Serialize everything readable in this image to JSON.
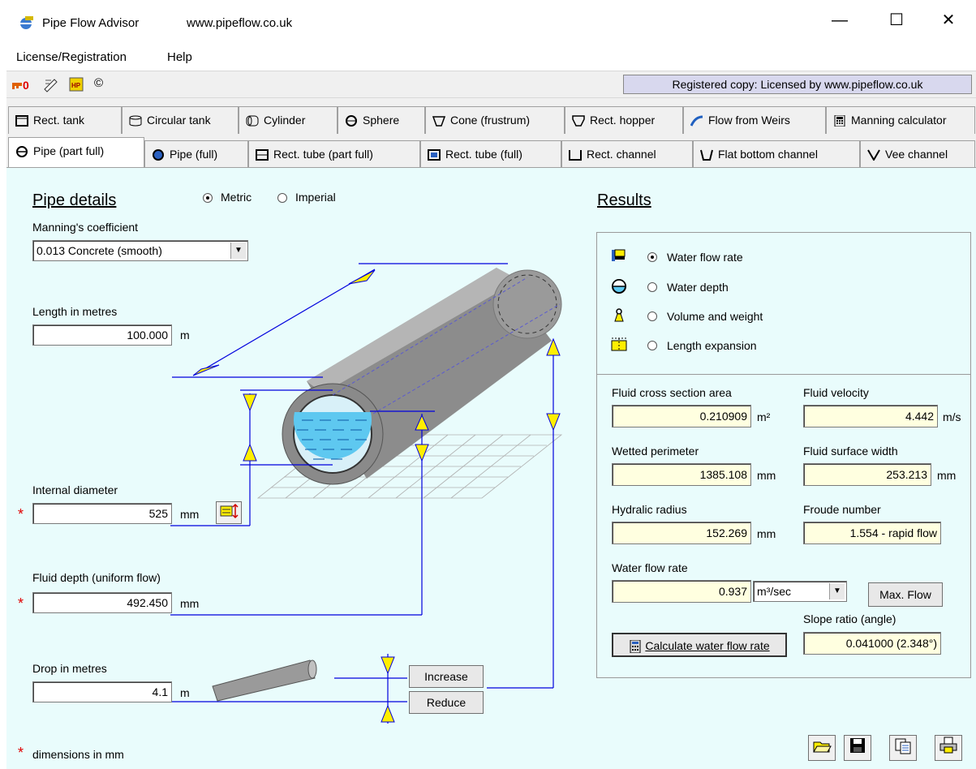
{
  "window": {
    "title": "Pipe Flow Advisor",
    "url": "www.pipeflow.co.uk",
    "minimize": "—",
    "maximize": "☐",
    "close": "✕"
  },
  "menu": [
    "License/Registration",
    "Help"
  ],
  "toolbar": {
    "copyright": "©",
    "registration": "Registered copy: Licensed by www.pipeflow.co.uk"
  },
  "tabs_row1": [
    "Rect. tank",
    "Circular tank",
    "Cylinder",
    "Sphere",
    "Cone (frustrum)",
    "Rect. hopper",
    "Flow from Weirs",
    "Manning calculator"
  ],
  "tabs_row2": [
    "Pipe (part full)",
    "Pipe (full)",
    "Rect. tube (part full)",
    "Rect. tube (full)",
    "Rect. channel",
    "Flat bottom channel",
    "Vee channel"
  ],
  "pipe": {
    "heading": "Pipe details",
    "metric": "Metric",
    "imperial": "Imperial",
    "manning_label": "Manning's coefficient",
    "manning_value": "0.013  Concrete (smooth)",
    "length_label": "Length  in metres",
    "length_value": "100.000",
    "length_unit": "m",
    "diameter_label": "Internal diameter",
    "diameter_value": "525",
    "diameter_unit": "mm",
    "depth_label": "Fluid depth (uniform flow)",
    "depth_value": "492.450",
    "depth_unit": "mm",
    "drop_label": "Drop  in metres",
    "drop_value": "4.1",
    "drop_unit": "m",
    "increase": "Increase",
    "reduce": "Reduce",
    "footnote_star": "*",
    "footnote": "dimensions in mm"
  },
  "results": {
    "heading": "Results",
    "options": [
      "Water flow rate",
      "Water depth",
      "Volume and weight",
      "Length expansion"
    ],
    "area_label": "Fluid cross section area",
    "area_value": "0.210909",
    "area_unit": "m²",
    "velocity_label": "Fluid velocity",
    "velocity_value": "4.442",
    "velocity_unit": "m/s",
    "perimeter_label": "Wetted perimeter",
    "perimeter_value": "1385.108",
    "perimeter_unit": "mm",
    "surface_label": "Fluid surface width",
    "surface_value": "253.213",
    "surface_unit": "mm",
    "radius_label": "Hydralic radius",
    "radius_value": "152.269",
    "radius_unit": "mm",
    "froude_label": "Froude number",
    "froude_value": "1.554 - rapid flow",
    "flow_label": "Water flow rate",
    "flow_value": "0.937",
    "flow_unit": "m³/sec",
    "max_flow": "Max. Flow",
    "slope_label": "Slope ratio (angle)",
    "slope_value": "0.041000 (2.348°)",
    "calculate": "Calculate water flow rate"
  },
  "colors": {
    "panel_bg": "#e9fcfc",
    "result_field_bg": "#ffffe0",
    "guide_line": "#0000dd",
    "arrow_yellow": "#ffee00",
    "required_star": "#e00000"
  }
}
